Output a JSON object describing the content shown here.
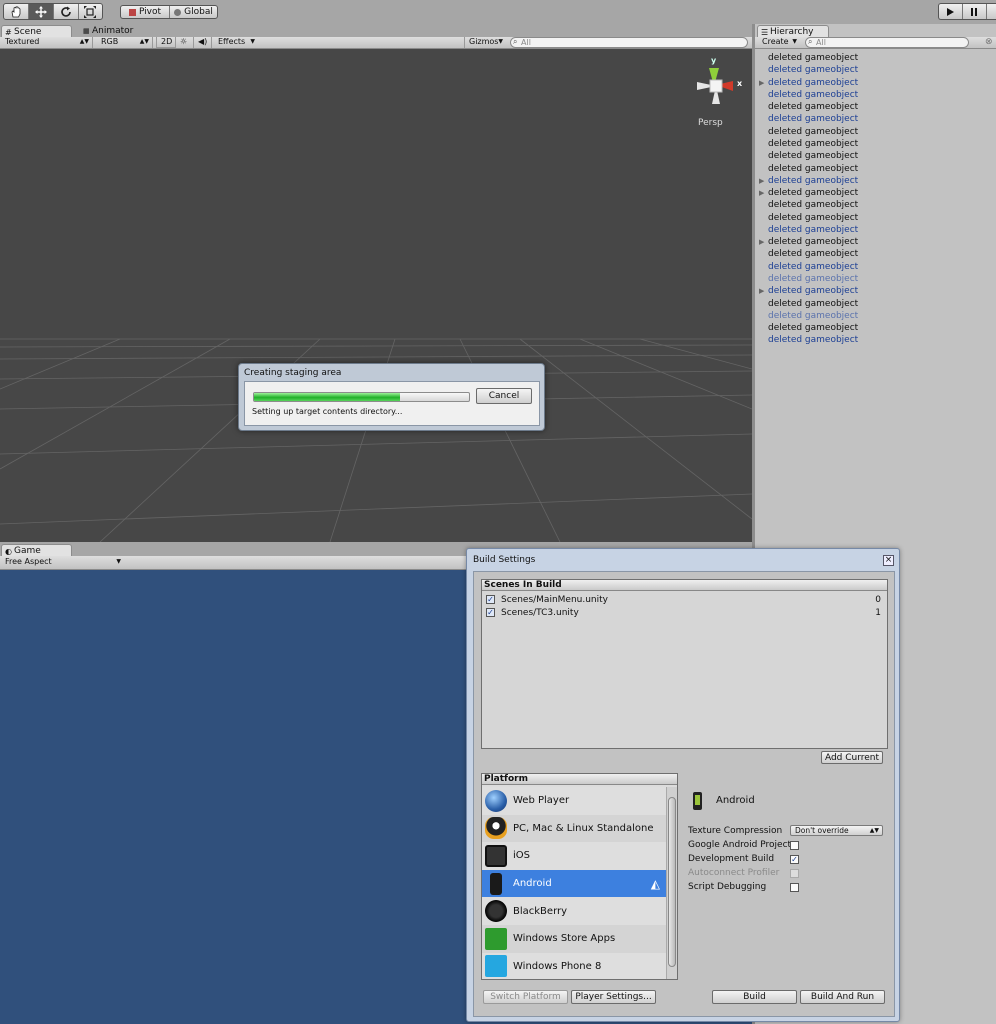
{
  "toolbar": {
    "tool_icons": [
      "hand-icon",
      "move-icon",
      "rotate-icon",
      "scale-icon"
    ],
    "pivot_label": "Pivot",
    "global_label": "Global",
    "play_icons": [
      "play-icon",
      "pause-icon",
      "step-icon"
    ]
  },
  "scene": {
    "tab_label": "Scene",
    "animator_tab_label": "Animator",
    "shading_mode": "Textured",
    "render_mode": "RGB",
    "mode_2d": "2D",
    "effects_label": "Effects",
    "gizmos_label": "Gizmos",
    "search_placeholder": "All",
    "gizmo_y": "y",
    "gizmo_x": "x",
    "persp_label": "Persp",
    "bg_color": "#474747"
  },
  "progress_dialog": {
    "title": "Creating staging area",
    "status": "Setting up target contents directory...",
    "cancel_label": "Cancel",
    "progress": 0.68
  },
  "hierarchy": {
    "tab_label": "Hierarchy",
    "create_label": "Create",
    "search_placeholder": "All",
    "items": [
      {
        "label": "deleted gameobject",
        "style": "black",
        "expand": false
      },
      {
        "label": "deleted gameobject",
        "style": "blue",
        "expand": false
      },
      {
        "label": "deleted gameobject",
        "style": "blue",
        "expand": true
      },
      {
        "label": "deleted gameobject",
        "style": "blue",
        "expand": false
      },
      {
        "label": "deleted gameobject",
        "style": "black",
        "expand": false
      },
      {
        "label": "deleted gameobject",
        "style": "blue",
        "expand": false
      },
      {
        "label": "deleted gameobject",
        "style": "black",
        "expand": false
      },
      {
        "label": "deleted gameobject",
        "style": "black",
        "expand": false
      },
      {
        "label": "deleted gameobject",
        "style": "black",
        "expand": false
      },
      {
        "label": "deleted gameobject",
        "style": "black",
        "expand": false
      },
      {
        "label": "deleted gameobject",
        "style": "blue",
        "expand": true
      },
      {
        "label": "deleted gameobject",
        "style": "black",
        "expand": true
      },
      {
        "label": "deleted gameobject",
        "style": "black",
        "expand": false
      },
      {
        "label": "deleted gameobject",
        "style": "black",
        "expand": false
      },
      {
        "label": "deleted gameobject",
        "style": "blue",
        "expand": false
      },
      {
        "label": "deleted gameobject",
        "style": "black",
        "expand": true
      },
      {
        "label": "deleted gameobject",
        "style": "black",
        "expand": false
      },
      {
        "label": "deleted gameobject",
        "style": "blue",
        "expand": false
      },
      {
        "label": "deleted gameobject",
        "style": "faded",
        "expand": false
      },
      {
        "label": "deleted gameobject",
        "style": "blue",
        "expand": true
      },
      {
        "label": "deleted gameobject",
        "style": "black",
        "expand": false
      },
      {
        "label": "deleted gameobject",
        "style": "faded",
        "expand": false
      },
      {
        "label": "deleted gameobject",
        "style": "black",
        "expand": false
      },
      {
        "label": "deleted gameobject",
        "style": "blue",
        "expand": false
      }
    ]
  },
  "game": {
    "tab_label": "Game",
    "aspect_label": "Free Aspect",
    "bg_color": "#30507c"
  },
  "build_settings": {
    "title": "Build Settings",
    "scenes_header": "Scenes In Build",
    "scenes": [
      {
        "path": "Scenes/MainMenu.unity",
        "index": "0",
        "checked": true
      },
      {
        "path": "Scenes/TC3.unity",
        "index": "1",
        "checked": true
      }
    ],
    "add_current_label": "Add Current",
    "platform_header": "Platform",
    "platforms": [
      {
        "label": "Web Player",
        "icon": "globe-icon"
      },
      {
        "label": "PC, Mac & Linux Standalone",
        "icon": "penguin-icon"
      },
      {
        "label": "iOS",
        "icon": "ipad-icon"
      },
      {
        "label": "Android",
        "icon": "android-phone-icon",
        "selected": true
      },
      {
        "label": "BlackBerry",
        "icon": "blackberry-icon"
      },
      {
        "label": "Windows Store Apps",
        "icon": "windows-store-icon"
      },
      {
        "label": "Windows Phone 8",
        "icon": "windows-phone-icon"
      }
    ],
    "selected_platform": "Android",
    "options": {
      "texture_compression_label": "Texture Compression",
      "texture_compression_value": "Don't override",
      "google_android_project_label": "Google Android Project",
      "google_android_project": false,
      "development_build_label": "Development Build",
      "development_build": true,
      "autoconnect_profiler_label": "Autoconnect Profiler",
      "autoconnect_profiler": false,
      "script_debugging_label": "Script Debugging",
      "script_debugging": false
    },
    "switch_platform_label": "Switch Platform",
    "player_settings_label": "Player Settings...",
    "build_label": "Build",
    "build_and_run_label": "Build And Run",
    "accent_color": "#3d80df"
  }
}
